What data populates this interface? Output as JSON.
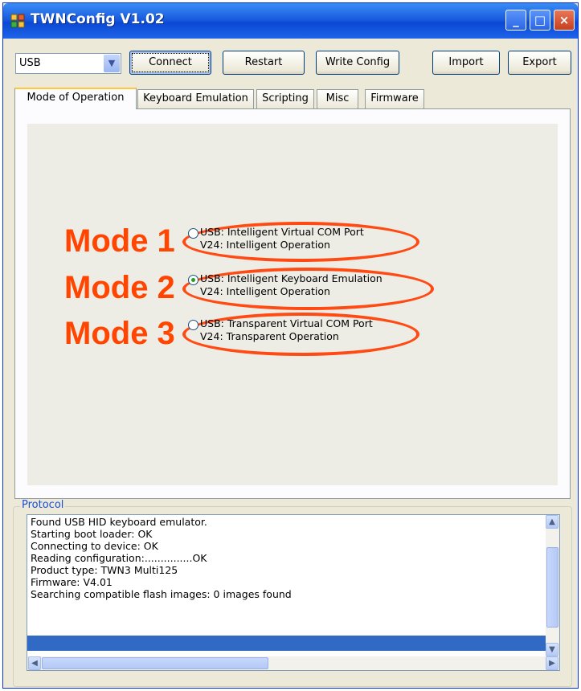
{
  "window": {
    "title": "TWNConfig V1.02",
    "icon": "app-icon",
    "controls": {
      "minimize": "_",
      "maximize": "□",
      "close": "×"
    }
  },
  "toolbar": {
    "port_select": {
      "value": "USB"
    },
    "connect_label": "Connect",
    "restart_label": "Restart",
    "write_config_label": "Write Config",
    "import_label": "Import",
    "export_label": "Export"
  },
  "tabs": [
    {
      "label": "Mode of Operation",
      "active": true
    },
    {
      "label": "Keyboard Emulation",
      "active": false
    },
    {
      "label": "Scripting",
      "active": false
    },
    {
      "label": "Misc",
      "active": false
    },
    {
      "label": "Firmware",
      "active": false
    }
  ],
  "modes": [
    {
      "label": "Mode 1",
      "line1": "USB: Intelligent Virtual COM Port",
      "line2": "V24: Intelligent Operation",
      "selected": false
    },
    {
      "label": "Mode 2",
      "line1": "USB: Intelligent Keyboard Emulation",
      "line2": "V24: Intelligent Operation",
      "selected": true
    },
    {
      "label": "Mode 3",
      "line1": "USB: Transparent Virtual COM Port",
      "line2": "V24: Transparent Operation",
      "selected": false
    }
  ],
  "protocol": {
    "legend": "Protocol",
    "lines": [
      "Found USB HID keyboard emulator.",
      "Starting boot loader: OK",
      "Connecting to device: OK",
      "Reading configuration:...............OK",
      "Product type: TWN3 Multi125",
      "Firmware: V4.01",
      "Searching compatible flash images: 0 images found"
    ]
  },
  "colors": {
    "annotation": "#ff4a14",
    "selection": "#316ac5",
    "titlebar": "#0b48d4"
  }
}
